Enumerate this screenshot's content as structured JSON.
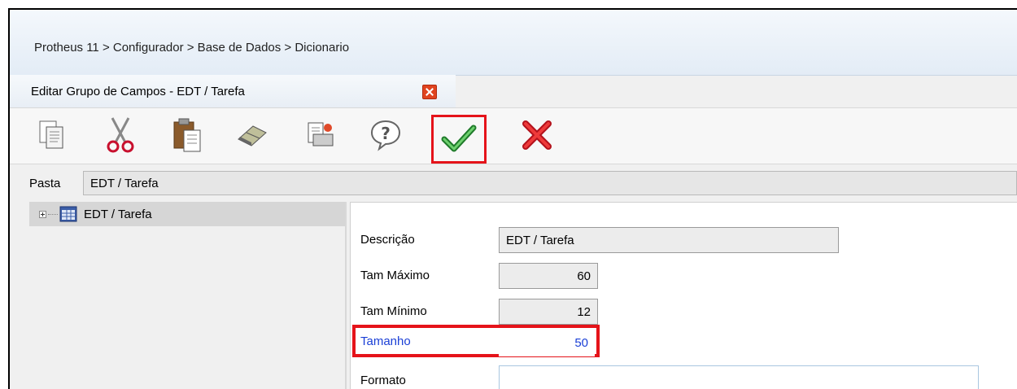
{
  "breadcrumb": "Protheus 11 > Configurador > Base de Dados > Dicionario",
  "window": {
    "title": "Editar Grupo de Campos - EDT / Tarefa"
  },
  "toolbar": {
    "buttons": [
      {
        "icon": "copy-icon"
      },
      {
        "icon": "cut-icon"
      },
      {
        "icon": "paste-icon"
      },
      {
        "icon": "eraser-icon"
      },
      {
        "icon": "print-preview-icon"
      },
      {
        "icon": "help-icon"
      },
      {
        "icon": "confirm-check-icon",
        "highlighted": true
      },
      {
        "icon": "cancel-x-icon"
      }
    ]
  },
  "folder": {
    "label": "Pasta",
    "value": "EDT / Tarefa"
  },
  "tree": {
    "items": [
      {
        "label": "EDT / Tarefa",
        "icon": "table-icon"
      }
    ]
  },
  "form": {
    "descricao": {
      "label": "Descrição",
      "value": "EDT / Tarefa"
    },
    "tam_maximo": {
      "label": "Tam Máximo",
      "value": "60"
    },
    "tam_minimo": {
      "label": "Tam Mínimo",
      "value": "12"
    },
    "tamanho": {
      "label": "Tamanho",
      "value": "50",
      "highlighted": true
    },
    "formato": {
      "label": "Formato",
      "value": ""
    }
  },
  "colors": {
    "highlight": "#e5131a",
    "blue_label": "#1a3fd6",
    "close": "#e0441f"
  }
}
